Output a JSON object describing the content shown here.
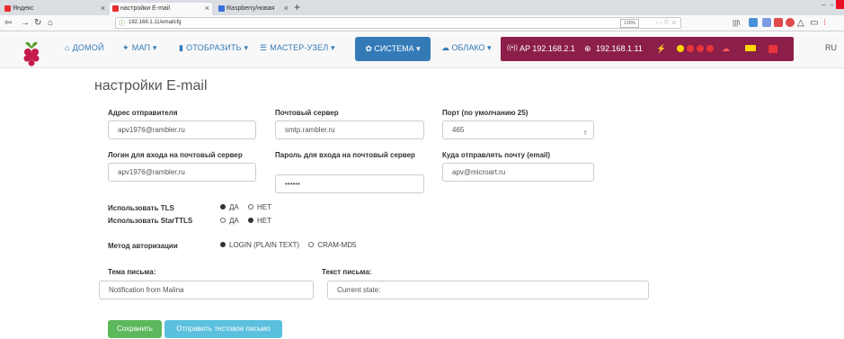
{
  "browser": {
    "tabs": [
      {
        "label": "Яндекс",
        "color": "#e62e2e"
      },
      {
        "label": "настройки E-mail",
        "color": "#e62e2e"
      },
      {
        "label": "Raspberry/новая",
        "color": "#3a6fd8"
      }
    ],
    "url": "192.168.1.11/emailcfg",
    "zoom": "120%"
  },
  "nav": {
    "home": "ДОМОЙ",
    "map": "МАП ▾",
    "display": "ОТОБРАЗИТЬ ▾",
    "master": "МАСТЕР-УЗЕЛ ▾",
    "system": "СИСТЕМА ▾",
    "cloud": "ОБЛАКО ▾",
    "ap": "AP 192.168.2.1",
    "ip": "192.168.1.11",
    "lang": "RU"
  },
  "form": {
    "title": "настройки E-mail",
    "sender_label": "Адрес отправителя",
    "sender_value": "apv1976@rambler.ru",
    "server_label": "Почтовый сервер",
    "server_value": "smtp.rambler.ru",
    "port_label": "Порт (по умолчанию 25)",
    "port_value": "465",
    "login_label": "Логин для входа на почтовый сервер",
    "login_value": "apv1976@rambler.ru",
    "password_label": "Пароль для входа на почтовый сервер",
    "password_value": "••••••",
    "dest_label": "Куда отправлять почту (email)",
    "dest_value": "apv@microart.ru",
    "tls_label": "Использовать TLS",
    "starttls_label": "Использовать StarTTLS",
    "yes": "ДА",
    "no": "НЕТ",
    "auth_label": "Метод авторизации",
    "auth_login": "LOGIN (PLAIN TEXT)",
    "auth_cram": "CRAM-MD5",
    "subject_label": "Тема письма:",
    "subject_value": "Notification from Malina",
    "body_label": "Текст письма:",
    "body_value": "Current state:",
    "save": "Сохранить",
    "send_test": "Отправить тестовое письмо"
  }
}
